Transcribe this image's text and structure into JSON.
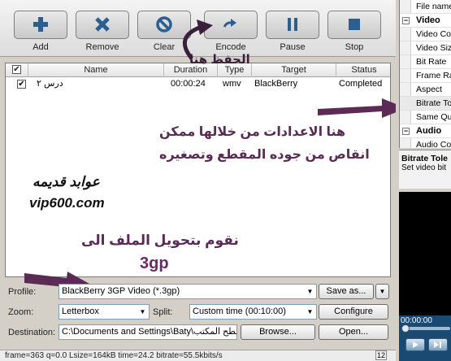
{
  "toolbar": {
    "buttons": [
      {
        "label": "Add",
        "icon": "plus-icon"
      },
      {
        "label": "Remove",
        "icon": "x-icon"
      },
      {
        "label": "Clear",
        "icon": "no-entry-icon"
      },
      {
        "label": "Encode",
        "icon": "arrow-forward-icon"
      },
      {
        "label": "Pause",
        "icon": "pause-icon"
      },
      {
        "label": "Stop",
        "icon": "stop-icon"
      }
    ],
    "icon_color": "#2b5f91"
  },
  "file_list": {
    "columns": [
      "Name",
      "Duration",
      "Type",
      "Target",
      "Status"
    ],
    "rows": [
      {
        "checked": true,
        "name": "درس ٢",
        "duration": "00:00:24",
        "type": "wmv",
        "target": "BlackBerry",
        "status": "Completed"
      }
    ]
  },
  "annotations": {
    "save_here": "الحفظ هنا",
    "settings_line1": "هنا الاعدادات من خلالها ممكن",
    "settings_line2": "انقاص من جوده المقطع وتصغيره",
    "signature_name": "عوابد قديمه",
    "signature_site": "vip600.com",
    "convert_line1": "نقوم بتحويل الملف الى",
    "convert_line2": "3gp",
    "text_color": "#5b2a55",
    "arrow_color": "#5b2a55"
  },
  "controls": {
    "profile_label": "Profile:",
    "profile_value": "BlackBerry 3GP Video  (*.3gp)",
    "save_as_label": "Save as...",
    "zoom_label": "Zoom:",
    "zoom_value": "Letterbox",
    "split_label": "Split:",
    "split_value": "Custom time (00:10:00)",
    "configure_label": "Configure",
    "destination_label": "Destination:",
    "destination_value": "C:\\Documents and Settings\\Baty\\سطح المكتب",
    "browse_label": "Browse...",
    "open_label": "Open..."
  },
  "status_bar": {
    "text": "frame=363 q=0.0 Lsize=164kB time=24.2 bitrate=55.5kbits/s",
    "number": "12"
  },
  "properties": {
    "rows": [
      {
        "label": "File name",
        "kind": "item"
      },
      {
        "label": "Video",
        "kind": "category"
      },
      {
        "label": "Video Co",
        "kind": "item"
      },
      {
        "label": "Video Siz",
        "kind": "item"
      },
      {
        "label": "Bit Rate",
        "kind": "item"
      },
      {
        "label": "Frame Ra",
        "kind": "item"
      },
      {
        "label": "Aspect",
        "kind": "item"
      },
      {
        "label": "Bitrate To",
        "kind": "selected"
      },
      {
        "label": "Same Qu",
        "kind": "item"
      },
      {
        "label": "Audio",
        "kind": "category"
      },
      {
        "label": "Audio Co",
        "kind": "item"
      }
    ],
    "description_title": "Bitrate Tole",
    "description_text": "Set video bit"
  },
  "player": {
    "time": "00:00:00"
  }
}
